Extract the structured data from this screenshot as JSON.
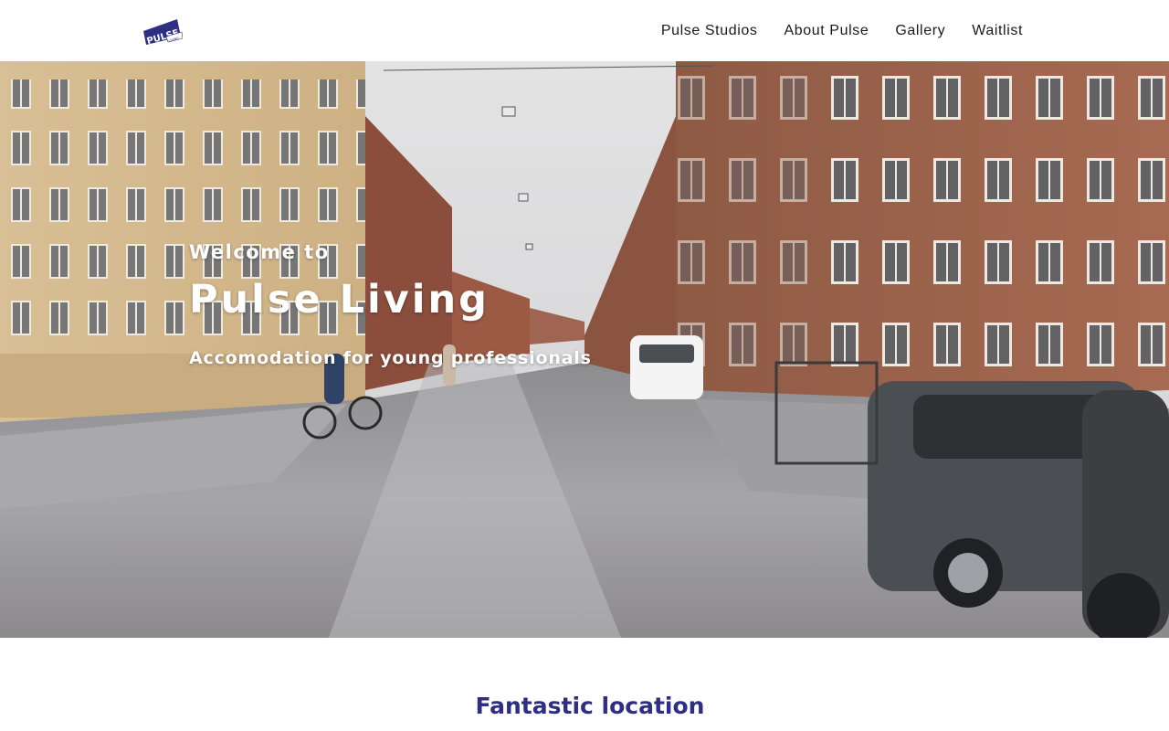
{
  "header": {
    "logo": {
      "text": "PULSE",
      "tagline": "LIVING",
      "color": "#2e2e83",
      "icon": "pulse-logo-icon"
    },
    "nav": [
      {
        "label": "Pulse Studios"
      },
      {
        "label": "About Pulse"
      },
      {
        "label": "Gallery"
      },
      {
        "label": "Waitlist"
      }
    ]
  },
  "hero": {
    "welcome": "Welcome to",
    "title": "Pulse Living",
    "subtitle": "Accomodation for young professionals"
  },
  "section": {
    "title": "Fantastic location",
    "title_color": "#2e2e83"
  }
}
